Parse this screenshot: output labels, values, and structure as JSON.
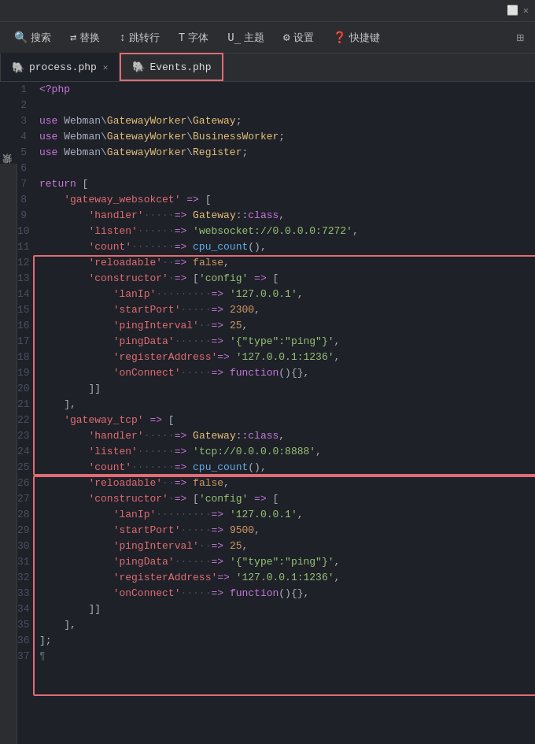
{
  "titleBar": {
    "icons": [
      "⬜",
      "✕"
    ]
  },
  "toolbar": {
    "search": "搜索",
    "replace": "替换",
    "goto": "跳转行",
    "font": "字体",
    "theme": "主题",
    "settings": "设置",
    "shortcuts": "快捷键"
  },
  "tabs": [
    {
      "id": "process",
      "label": "process.php",
      "active": true,
      "closable": true
    },
    {
      "id": "events",
      "label": "Events.php",
      "active": false,
      "closable": false,
      "highlighted": true
    }
  ],
  "sideLabel": "搜索",
  "lines": [
    {
      "num": 1,
      "code": "<?php"
    },
    {
      "num": 2,
      "code": ""
    },
    {
      "num": 3,
      "code": "use Webman\\GatewayWorker\\Gateway;"
    },
    {
      "num": 4,
      "code": "use Webman\\GatewayWorker\\BusinessWorker;"
    },
    {
      "num": 5,
      "code": "use Webman\\GatewayWorker\\Register;"
    },
    {
      "num": 6,
      "code": ""
    },
    {
      "num": 7,
      "code": "return ["
    },
    {
      "num": 8,
      "code": "    'gateway_websokcet' => ["
    },
    {
      "num": 9,
      "code": "        'handler'·····=> Gateway::class,"
    },
    {
      "num": 10,
      "code": "        'listen'······=> 'websocket://0.0.0.0:7272',"
    },
    {
      "num": 11,
      "code": "        'count'·······=> cpu_count(),"
    },
    {
      "num": 12,
      "code": "        'reloadable'··=> false,"
    },
    {
      "num": 13,
      "code": "        'constructor'·=> ['config' => ["
    },
    {
      "num": 14,
      "code": "            'lanIp'·········=> '127.0.0.1',"
    },
    {
      "num": 15,
      "code": "            'startPort'·····=> 2300,"
    },
    {
      "num": 16,
      "code": "            'pingInterval'··=> 25,"
    },
    {
      "num": 17,
      "code": "            'pingData'······=> '{\"type\":\"ping\"}',"
    },
    {
      "num": 18,
      "code": "            'registerAddress'=> '127.0.0.1:1236',"
    },
    {
      "num": 19,
      "code": "            'onConnect'·····=> function(){},"
    },
    {
      "num": 20,
      "code": "        ]]"
    },
    {
      "num": 21,
      "code": "    ],"
    },
    {
      "num": 22,
      "code": "    'gateway_tcp' => ["
    },
    {
      "num": 23,
      "code": "        'handler'·····=> Gateway::class,"
    },
    {
      "num": 24,
      "code": "        'listen'······=> 'tcp://0.0.0.0:8888',"
    },
    {
      "num": 25,
      "code": "        'count'·······=> cpu_count(),"
    },
    {
      "num": 26,
      "code": "        'reloadable'··=> false,"
    },
    {
      "num": 27,
      "code": "        'constructor'·=> ['config' => ["
    },
    {
      "num": 28,
      "code": "            'lanIp'·········=> '127.0.0.1',"
    },
    {
      "num": 29,
      "code": "            'startPort'·····=> 9500,"
    },
    {
      "num": 30,
      "code": "            'pingInterval'··=> 25,"
    },
    {
      "num": 31,
      "code": "            'pingData'······=> '{\"type\":\"ping\"}',"
    },
    {
      "num": 32,
      "code": "            'registerAddress'=> '127.0.0.1:1236',"
    },
    {
      "num": 33,
      "code": "            'onConnect'·····=> function(){},"
    },
    {
      "num": 34,
      "code": "        ]]"
    },
    {
      "num": 35,
      "code": "    ],"
    },
    {
      "num": 36,
      "code": "];"
    },
    {
      "num": 37,
      "code": "¶"
    }
  ]
}
